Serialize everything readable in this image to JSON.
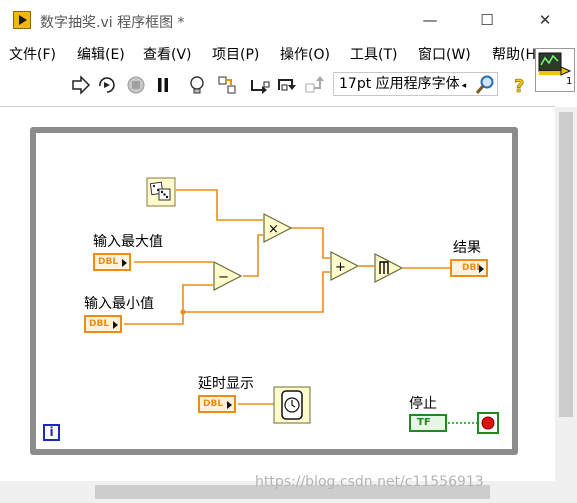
{
  "window": {
    "title": "数字抽奖.vi 程序框图 *",
    "minimize": "—",
    "maximize": "☐",
    "close": "✕"
  },
  "menu": [
    {
      "label": "文件(F)"
    },
    {
      "label": "编辑(E)"
    },
    {
      "label": "查看(V)"
    },
    {
      "label": "项目(P)"
    },
    {
      "label": "操作(O)"
    },
    {
      "label": "工具(T)"
    },
    {
      "label": "窗口(W)"
    },
    {
      "label": "帮助(H)"
    }
  ],
  "toolbar": {
    "font": "17pt 应用程序字体",
    "icons": [
      "run-arrow-icon",
      "run-continuous-icon",
      "abort-icon",
      "pause-icon",
      "highlight-execution-icon",
      "retain-wire-values-icon",
      "step-into-icon",
      "step-over-icon",
      "step-out-icon",
      "search-icon",
      "help-icon"
    ],
    "vi_icon_number": "1"
  },
  "diagram": {
    "controls": [
      {
        "label": "输入最大值",
        "type": "DBL"
      },
      {
        "label": "输入最小值",
        "type": "DBL"
      },
      {
        "label": "延时显示",
        "type": "DBL"
      }
    ],
    "indicators": [
      {
        "label": "结果",
        "type": "DBL"
      }
    ],
    "stop": {
      "label": "停止",
      "type": "TF"
    },
    "loop_index": "i",
    "functions": {
      "multiply": "×",
      "subtract": "−",
      "add": "+"
    }
  },
  "watermark": "https://blog.csdn.net/c11556913",
  "colors": {
    "dbl_orange": "#f08c14",
    "bool_green": "#1c8c1c",
    "loop_gray": "#8c8c8c",
    "function_fill": "#fffbcc"
  }
}
